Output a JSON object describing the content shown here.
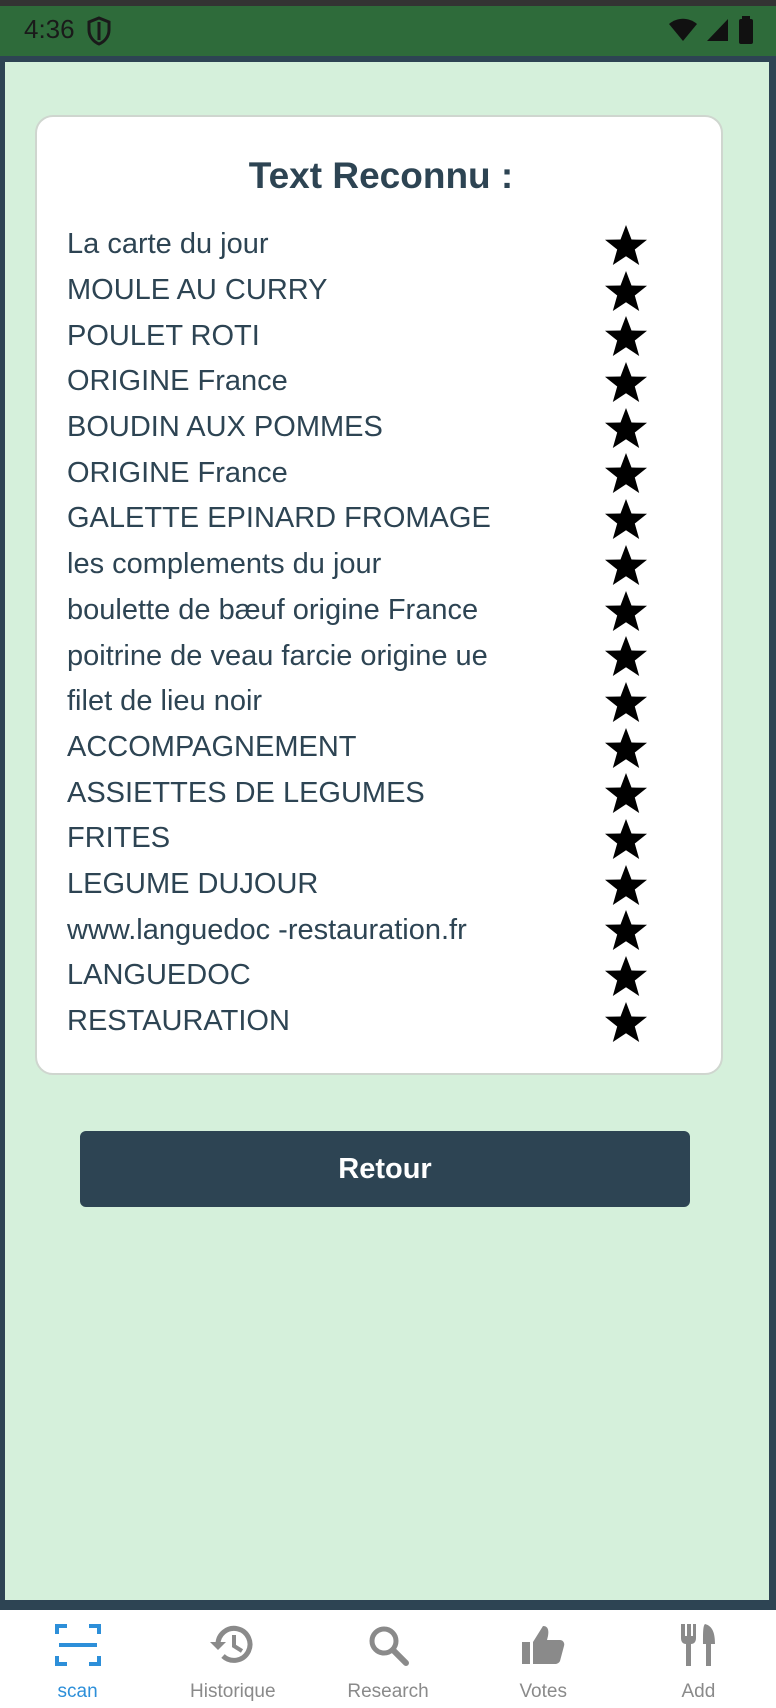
{
  "status": {
    "time": "4:36"
  },
  "card": {
    "title": "Text Reconnu :",
    "items": [
      "La carte du jour",
      "MOULE AU CURRY",
      "POULET ROTI",
      "ORIGINE France",
      "BOUDIN AUX POMMES",
      "ORIGINE France",
      "GALETTE EPINARD FROMAGE",
      "les complements du jour",
      "boulette de bæuf origine France",
      "poitrine de veau farcie origine ue",
      "filet de lieu noir",
      "ACCOMPAGNEMENT",
      "ASSIETTES DE LEGUMES",
      "FRITES",
      "LEGUME DUJOUR",
      "www.languedoc -restauration.fr",
      "LANGUEDOC",
      "RESTAURATION"
    ]
  },
  "retour_label": "Retour",
  "nav": [
    {
      "label": "scan",
      "icon": "scan-icon",
      "active": true
    },
    {
      "label": "Historique",
      "icon": "history-icon",
      "active": false
    },
    {
      "label": "Research",
      "icon": "search-icon",
      "active": false
    },
    {
      "label": "Votes",
      "icon": "thumbs-up-icon",
      "active": false
    },
    {
      "label": "Add",
      "icon": "fork-knife-icon",
      "active": false
    }
  ],
  "colors": {
    "primary": "#2d4453",
    "background": "#d5f0db",
    "status_bar": "#2e6b3a",
    "nav_active": "#2d8fd9"
  }
}
